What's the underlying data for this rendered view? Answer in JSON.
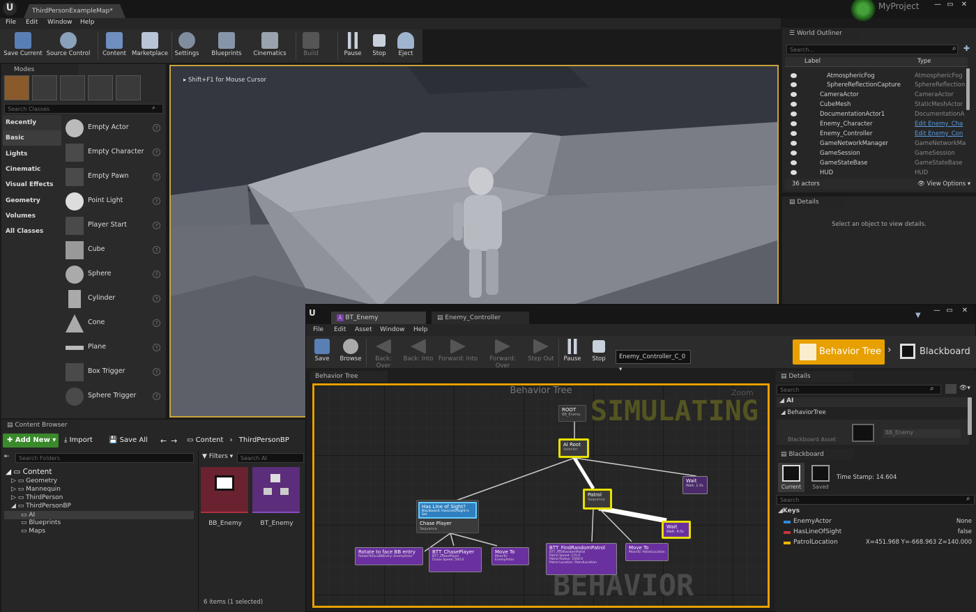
{
  "window": {
    "tab_title": "ThirdPersonExampleMap*",
    "project": "MyProject"
  },
  "menu": [
    "File",
    "Edit",
    "Window",
    "Help"
  ],
  "toolbar": [
    {
      "label": "Save Current",
      "icon": "save-icon"
    },
    {
      "label": "Source Control",
      "icon": "source-control-icon"
    },
    {
      "label": "Content",
      "icon": "content-icon"
    },
    {
      "label": "Marketplace",
      "icon": "marketplace-icon"
    },
    {
      "label": "Settings",
      "icon": "settings-icon"
    },
    {
      "label": "Blueprints",
      "icon": "blueprints-icon"
    },
    {
      "label": "Cinematics",
      "icon": "cinematics-icon"
    },
    {
      "label": "Build",
      "icon": "build-icon"
    },
    {
      "label": "Pause",
      "icon": "pause-icon"
    },
    {
      "label": "Stop",
      "icon": "stop-icon"
    },
    {
      "label": "Eject",
      "icon": "eject-icon"
    }
  ],
  "modes": {
    "title": "Modes",
    "search_placeholder": "Search Classes",
    "categories": [
      "Recently Placed",
      "Basic",
      "Lights",
      "Cinematic",
      "Visual Effects",
      "Geometry",
      "Volumes",
      "All Classes"
    ],
    "items": [
      "Empty Actor",
      "Empty Character",
      "Empty Pawn",
      "Point Light",
      "Player Start",
      "Cube",
      "Sphere",
      "Cylinder",
      "Cone",
      "Plane",
      "Box Trigger",
      "Sphere Trigger"
    ]
  },
  "viewport": {
    "hint": "Shift+F1 for Mouse Cursor"
  },
  "outliner": {
    "title": "World Outliner",
    "search_placeholder": "Search...",
    "col_label": "Label",
    "col_type": "Type",
    "rows": [
      {
        "label": "AtmosphericFog",
        "type": "AtmosphericFog",
        "indent": 1,
        "link": false
      },
      {
        "label": "SphereReflectionCapture",
        "type": "SphereReflection",
        "indent": 1,
        "link": false
      },
      {
        "label": "CameraActor",
        "type": "CameraActor",
        "indent": 0,
        "link": false
      },
      {
        "label": "CubeMesh",
        "type": "StaticMeshActor",
        "indent": 0,
        "link": false
      },
      {
        "label": "DocumentationActor1",
        "type": "DocumentationA",
        "indent": 0,
        "link": false
      },
      {
        "label": "Enemy_Character",
        "type": "Edit Enemy_Cha",
        "indent": 0,
        "link": true
      },
      {
        "label": "Enemy_Controller",
        "type": "Edit Enemy_Con",
        "indent": 0,
        "link": true
      },
      {
        "label": "GameNetworkManager",
        "type": "GameNetworkMa",
        "indent": 0,
        "link": false
      },
      {
        "label": "GameSession",
        "type": "GameSession",
        "indent": 0,
        "link": false
      },
      {
        "label": "GameStateBase",
        "type": "GameStateBase",
        "indent": 0,
        "link": false
      },
      {
        "label": "HUD",
        "type": "HUD",
        "indent": 0,
        "link": false
      }
    ],
    "count": "36 actors",
    "view_options": "View Options"
  },
  "details": {
    "title": "Details",
    "empty_text": "Select an object to view details."
  },
  "content_browser": {
    "title": "Content Browser",
    "add_new": "Add New",
    "import": "Import",
    "save_all": "Save All",
    "path": [
      "Content",
      "ThirdPersonBP"
    ],
    "search_folders": "Search Folders",
    "filters": "Filters",
    "search_ai": "Search AI",
    "tree": [
      {
        "label": "Content",
        "level": 0
      },
      {
        "label": "Geometry",
        "level": 1
      },
      {
        "label": "Mannequin",
        "level": 1
      },
      {
        "label": "ThirdPerson",
        "level": 1
      },
      {
        "label": "ThirdPersonBP",
        "level": 1
      },
      {
        "label": "AI",
        "level": 2
      },
      {
        "label": "Blueprints",
        "level": 2
      },
      {
        "label": "Maps",
        "level": 2
      }
    ],
    "assets": [
      {
        "name": "BB_Enemy"
      },
      {
        "name": "BT_Enemy"
      }
    ],
    "status": "6 items (1 selected)"
  },
  "bt": {
    "tabs": [
      "BT_Enemy",
      "Enemy_Controller"
    ],
    "menu": [
      "File",
      "Edit",
      "Asset",
      "Window",
      "Help"
    ],
    "toolbar": [
      {
        "label": "Save",
        "icon": "save-icon"
      },
      {
        "label": "Browse",
        "icon": "browse-icon"
      },
      {
        "label": "Back: Over",
        "icon": "back-over-icon"
      },
      {
        "label": "Back: Into",
        "icon": "back-into-icon"
      },
      {
        "label": "Forward: Into",
        "icon": "forward-into-icon"
      },
      {
        "label": "Forward: Over",
        "icon": "forward-over-icon"
      },
      {
        "label": "Step Out",
        "icon": "step-out-icon"
      },
      {
        "label": "Pause",
        "icon": "pause-icon"
      },
      {
        "label": "Stop",
        "icon": "stop-icon"
      }
    ],
    "debug_select": "Enemy_Controller_C_0",
    "mode_bt": "Behavior Tree",
    "mode_bb": "Blackboard",
    "graph_tab": "Behavior Tree",
    "graph_title": "Behavior Tree",
    "zoom": "Zoom",
    "simulating": "SIMULATING",
    "watermark": "BEHAVIOR TREE",
    "nodes": {
      "root": "ROOT",
      "root_sub": "BB_Enemy",
      "ai_root": "AI Root",
      "ai_root_sub": "Selector",
      "wait1": "Wait",
      "wait1_sub": "Wait: 1.0s",
      "patrol": "Patrol",
      "patrol_sub": "Sequence",
      "has_los": "Has Line of Sight?",
      "has_los_sub": "Blackboard: HasLineOfSight is Set",
      "chase": "Chase Player",
      "chase_sub": "Sequence",
      "wait2": "Wait",
      "wait2_sub": "Wait: 4.0s",
      "rotate": "Rotate to face BB entry",
      "rotate_sub": "RotateToFaceBBEntry: EnemyActor",
      "btt_chase": "BTT_ChasePlayer",
      "btt_chase_sub": "BTT_ChasePlayer",
      "btt_chase_speed": "Chase Speed: 500.0",
      "moveto1": "Move To",
      "moveto1_sub": "MoveTo: EnemyActor",
      "find_patrol": "BTT_FindRandomPatrol",
      "find_patrol_sub": "BTT_FindRandomPatrol",
      "find_patrol_l1": "Patrol Speed: 125.0",
      "find_patrol_l2": "Patrol Radius: 1000.0",
      "find_patrol_l3": "Patrol Location: PatrolLocation",
      "moveto2": "Move To",
      "moveto2_sub": "MoveTo: PatrolLocation"
    }
  },
  "bt_details": {
    "title": "Details",
    "search": "Search",
    "section": "AI",
    "sub": "BehaviorTree",
    "asset_label": "Blackboard Asset",
    "asset_value": "BB_Enemy"
  },
  "blackboard": {
    "title": "Blackboard",
    "current": "Current",
    "saved": "Saved",
    "timestamp": "Time Stamp: 14.604",
    "search": "Search",
    "keys_title": "Keys",
    "keys": [
      {
        "name": "EnemyActor",
        "value": "None",
        "color": "#2f8ad6"
      },
      {
        "name": "HasLineOfSight",
        "value": "false",
        "color": "#c8343a"
      },
      {
        "name": "PatrolLocation",
        "value": "X=451.968 Y=-668.963 Z=140.000",
        "color": "#e8b800"
      }
    ]
  }
}
